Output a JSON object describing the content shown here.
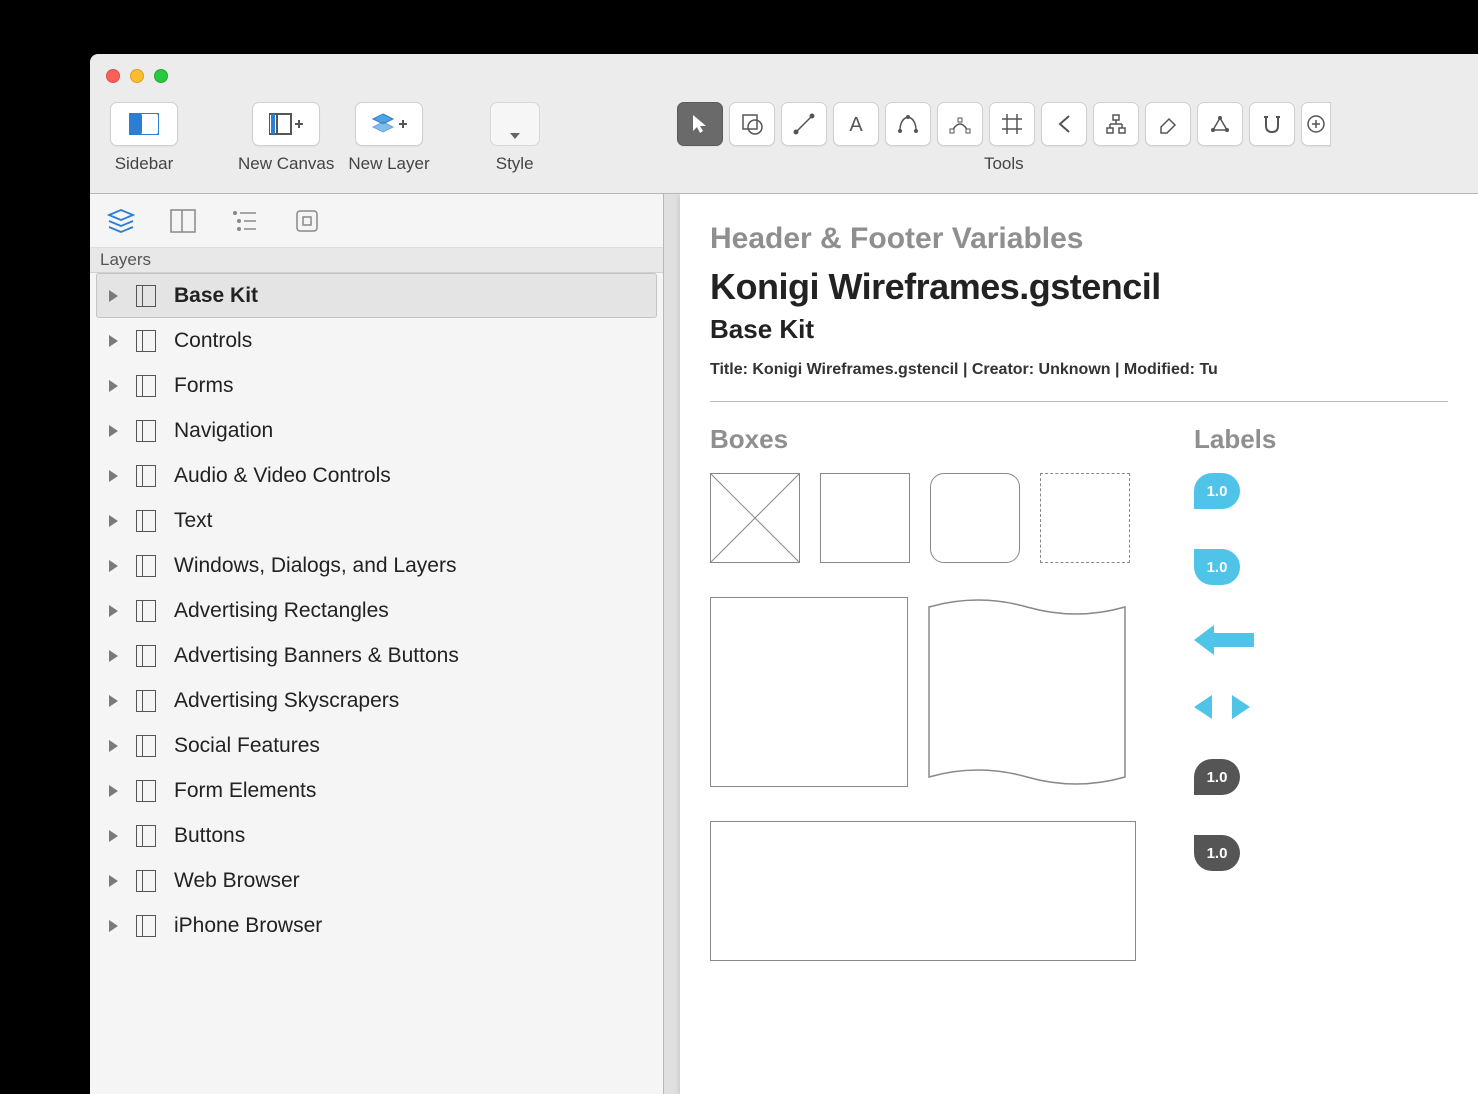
{
  "toolbar": {
    "sidebar_label": "Sidebar",
    "new_canvas_label": "New Canvas",
    "new_layer_label": "New Layer",
    "style_label": "Style",
    "tools_label": "Tools"
  },
  "sidebar": {
    "section_label": "Layers",
    "items": [
      {
        "label": "Base Kit",
        "selected": true
      },
      {
        "label": "Controls"
      },
      {
        "label": "Forms"
      },
      {
        "label": "Navigation"
      },
      {
        "label": "Audio & Video Controls"
      },
      {
        "label": "Text"
      },
      {
        "label": "Windows, Dialogs, and Layers"
      },
      {
        "label": "Advertising Rectangles"
      },
      {
        "label": "Advertising Banners & Buttons"
      },
      {
        "label": "Advertising Skyscrapers"
      },
      {
        "label": "Social Features"
      },
      {
        "label": "Form Elements"
      },
      {
        "label": "Buttons"
      },
      {
        "label": "Web Browser"
      },
      {
        "label": "iPhone Browser"
      }
    ]
  },
  "canvas": {
    "header_footer_title": "Header & Footer Variables",
    "document_title": "Konigi Wireframes.gstencil",
    "subtitle": "Base Kit",
    "meta_line": "Title: Konigi Wireframes.gstencil  |  Creator: Unknown  |  Modified: Tu",
    "boxes_label": "Boxes",
    "labels_label": "Labels",
    "pins": [
      "1.0",
      "1.0",
      "1.0",
      "1.0"
    ]
  }
}
